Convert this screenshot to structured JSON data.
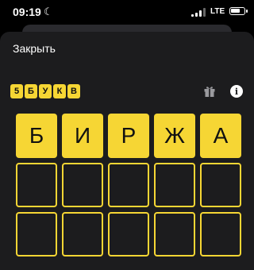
{
  "status": {
    "time": "09:19",
    "network": "LTE",
    "battery_level": 0.7
  },
  "header": {
    "close_label": "Закрыть"
  },
  "badge": {
    "letters": [
      "5",
      "Б",
      "У",
      "К",
      "В"
    ]
  },
  "icons": {
    "gift": "gift-icon",
    "info": "info-icon",
    "info_glyph": "i"
  },
  "board": {
    "rows": [
      [
        "Б",
        "И",
        "Р",
        "Ж",
        "А"
      ],
      [
        "",
        "",
        "",
        "",
        ""
      ],
      [
        "",
        "",
        "",
        "",
        ""
      ]
    ]
  },
  "colors": {
    "accent": "#f6d634",
    "sheet": "#1c1c1e",
    "background": "#000000"
  }
}
